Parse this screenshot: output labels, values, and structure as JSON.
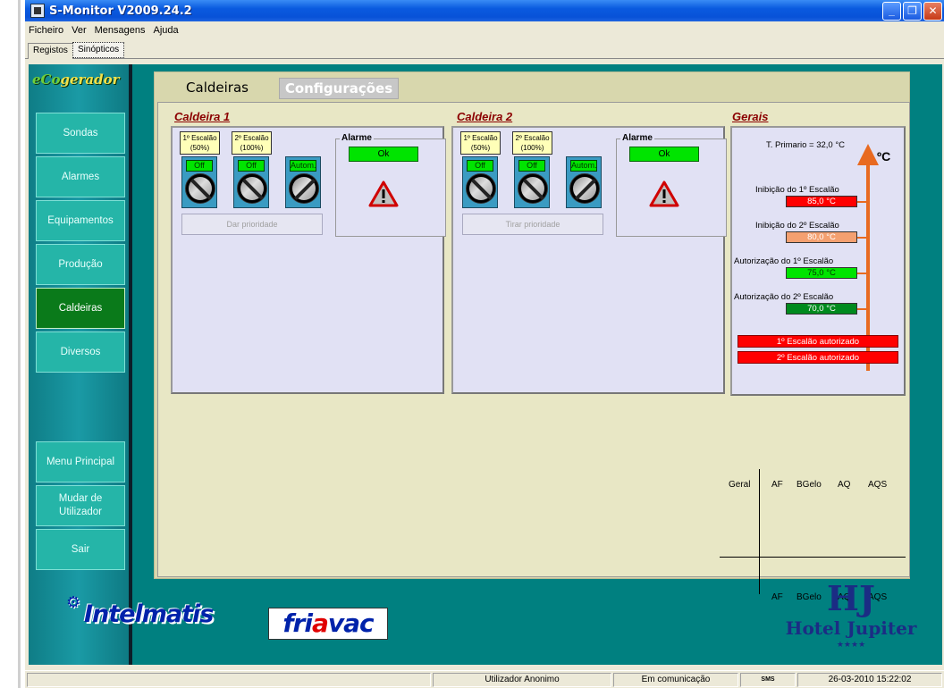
{
  "window": {
    "title": "S-Monitor V2009.24.2"
  },
  "menu": [
    "Ficheiro",
    "Ver",
    "Mensagens",
    "Ajuda"
  ],
  "view_tabs": [
    "Registos",
    "Sinópticos"
  ],
  "sidebar": {
    "logo": {
      "prefix": "eCo",
      "rest": "gerador"
    },
    "items": [
      {
        "label": "Sondas"
      },
      {
        "label": "Alarmes"
      },
      {
        "label": "Equipamentos"
      },
      {
        "label": "Produção"
      },
      {
        "label": "Caldeiras",
        "active": true
      },
      {
        "label": "Diversos"
      }
    ],
    "bottom": [
      {
        "label": "Menu Principal"
      },
      {
        "label": "Mudar de Utilizador"
      },
      {
        "label": "Sair"
      }
    ]
  },
  "tabs": {
    "active": "Caldeiras",
    "other": "Configurações"
  },
  "caldeira1": {
    "title": "Caldeira 1",
    "esc1": "1º Escalão (50%)",
    "esc2": "2º Escalão (100%)",
    "s1": "Off",
    "s2": "Off",
    "s3": "Autom.",
    "prio": "Dar prioridade",
    "alarm_title": "Alarme",
    "alarm_status": "Ok"
  },
  "caldeira2": {
    "title": "Caldeira 2",
    "esc1": "1º Escalão (50%)",
    "esc2": "2º Escalão (100%)",
    "s1": "Off",
    "s2": "Off",
    "s3": "Autom.",
    "prio": "Tirar prioridade",
    "alarm_title": "Alarme",
    "alarm_status": "Ok"
  },
  "gerais": {
    "title": "Gerais",
    "t_primario": "T. Primario = 32,0 °C",
    "unit": "ºC",
    "rows": [
      {
        "label": "Inibição do 1º Escalão",
        "value": "85,0 °C",
        "color": "#FF0000",
        "text_color": "#FFFFFF"
      },
      {
        "label": "Inibição do 2º Escalão",
        "value": "80,0 °C",
        "color": "#F4A070",
        "text_color": "#FFFFFF"
      },
      {
        "label": "Autorização do 1º Escalão",
        "value": "75,0 °C",
        "color": "#00E400",
        "text_color": "#003300"
      },
      {
        "label": "Autorização do 2º Escalão",
        "value": "70,0 °C",
        "color": "#008A1E",
        "text_color": "#FFFFFF"
      }
    ],
    "auth1": "1º Escalão autorizado",
    "auth2": "2º Escalão autorizado"
  },
  "grid": {
    "top": [
      "Geral",
      "AF",
      "BGelo",
      "AQ",
      "AQS"
    ],
    "bottom": [
      "AF",
      "BGelo",
      "AQ",
      "AQS"
    ]
  },
  "logos": {
    "intelmatis": "Intelmatis",
    "friavac_pre": "fri",
    "friavac_a": "a",
    "friavac_post": "vac",
    "hotel_mark": "HJ",
    "hotel_name": "Hotel Jupiter",
    "hotel_stars": "★★★★"
  },
  "status": {
    "user": "Utilizador Anonimo",
    "comm": "Em comunicação",
    "sms": "SMS",
    "datetime": "26-03-2010 15:22:02"
  },
  "colors": {
    "teal": "#008080",
    "ok_green": "#00E400",
    "alarm_red": "#FF0000",
    "arrow": "#E86A20"
  }
}
